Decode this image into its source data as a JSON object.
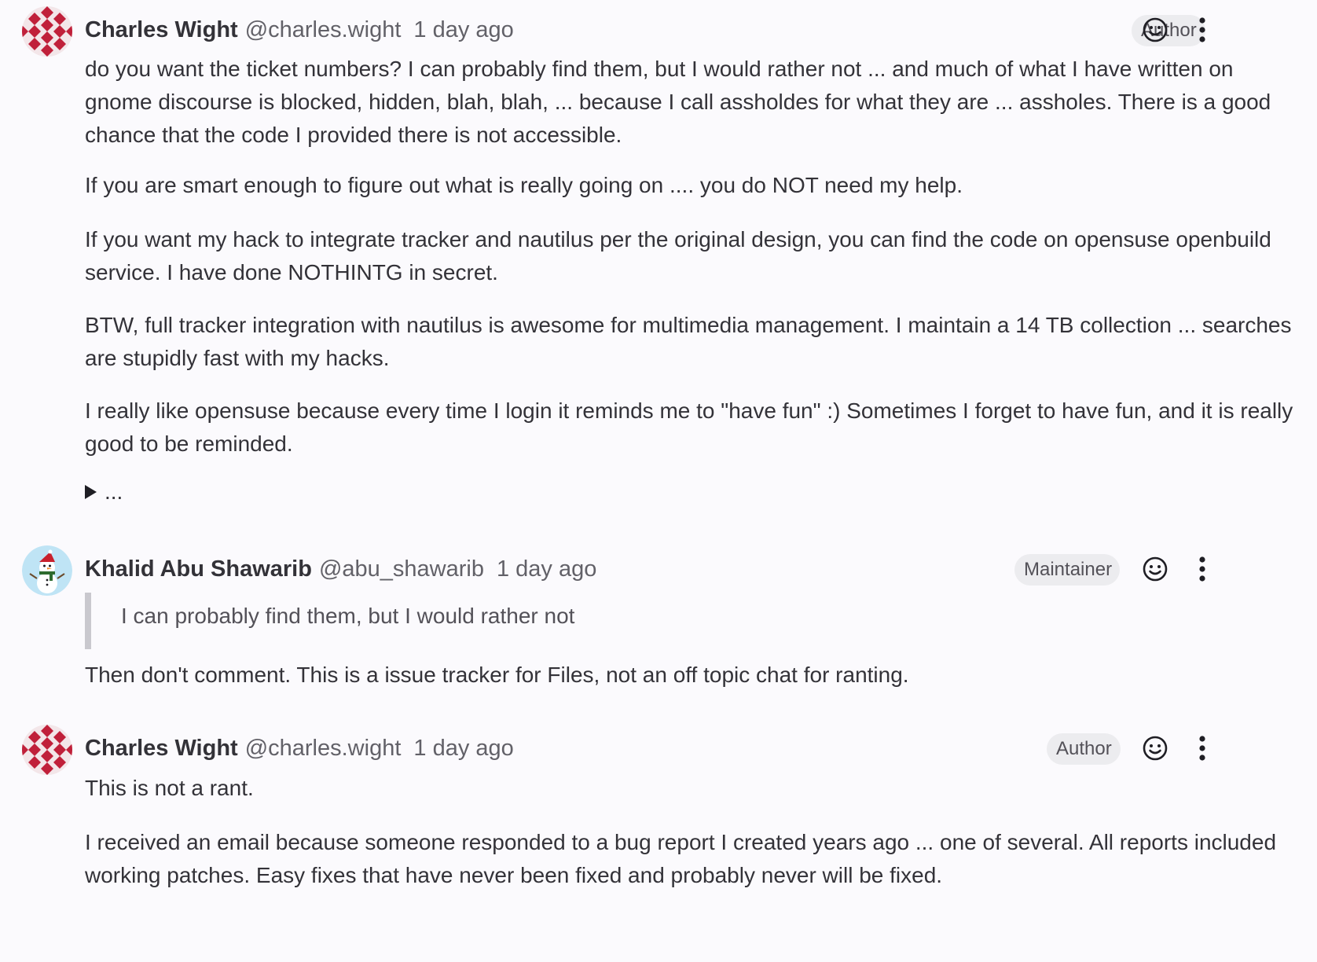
{
  "notes": [
    {
      "author": "Charles Wight",
      "handle": "@charles.wight",
      "time": "1 day ago",
      "role": "Author",
      "avatar_icon": "geometric-pattern-avatar",
      "paragraphs": [
        "do you want the ticket numbers? I can probably find them, but I would rather not ... and much of what I have written on gnome discourse is blocked, hidden, blah, blah, ... because I call assholdes for what they are ... assholes. There is a good chance that the code I provided there is not accessible.",
        "If you are smart enough to figure out what is really going on .... you do NOT need my help.",
        "If you want my hack to integrate tracker and nautilus per the original design, you can find the code on opensuse openbuild service. I have done NOTHINTG in secret.",
        "BTW, full tracker integration with nautilus is awesome for multimedia management. I maintain a 14 TB collection ... searches are stupidly fast with my hacks.",
        "I really like opensuse because every time I login it reminds me to \"have fun\" :) Sometimes I forget to have fun, and it is really good to be reminded."
      ],
      "collapsed_label": "..."
    },
    {
      "author": "Khalid Abu Shawarib",
      "handle": "@abu_shawarib",
      "time": "1 day ago",
      "role": "Maintainer",
      "avatar_icon": "snowman-avatar",
      "quote": "I can probably find them, but I would rather not",
      "paragraphs": [
        "Then don't comment. This is a issue tracker for Files, not an off topic chat for ranting."
      ]
    },
    {
      "author": "Charles Wight",
      "handle": "@charles.wight",
      "time": "1 day ago",
      "role": "Author",
      "avatar_icon": "geometric-pattern-avatar",
      "paragraphs": [
        "This is not a rant.",
        "I received an email because someone responded to a bug report I created years ago ... one of several. All reports included working patches. Easy fixes that have never been fixed and probably never will be fixed."
      ]
    }
  ],
  "colors": {
    "background": "#fbfafd",
    "text": "#333238",
    "muted": "#626168",
    "badge_bg": "#ececef",
    "avatar_red": "#c0203a"
  }
}
